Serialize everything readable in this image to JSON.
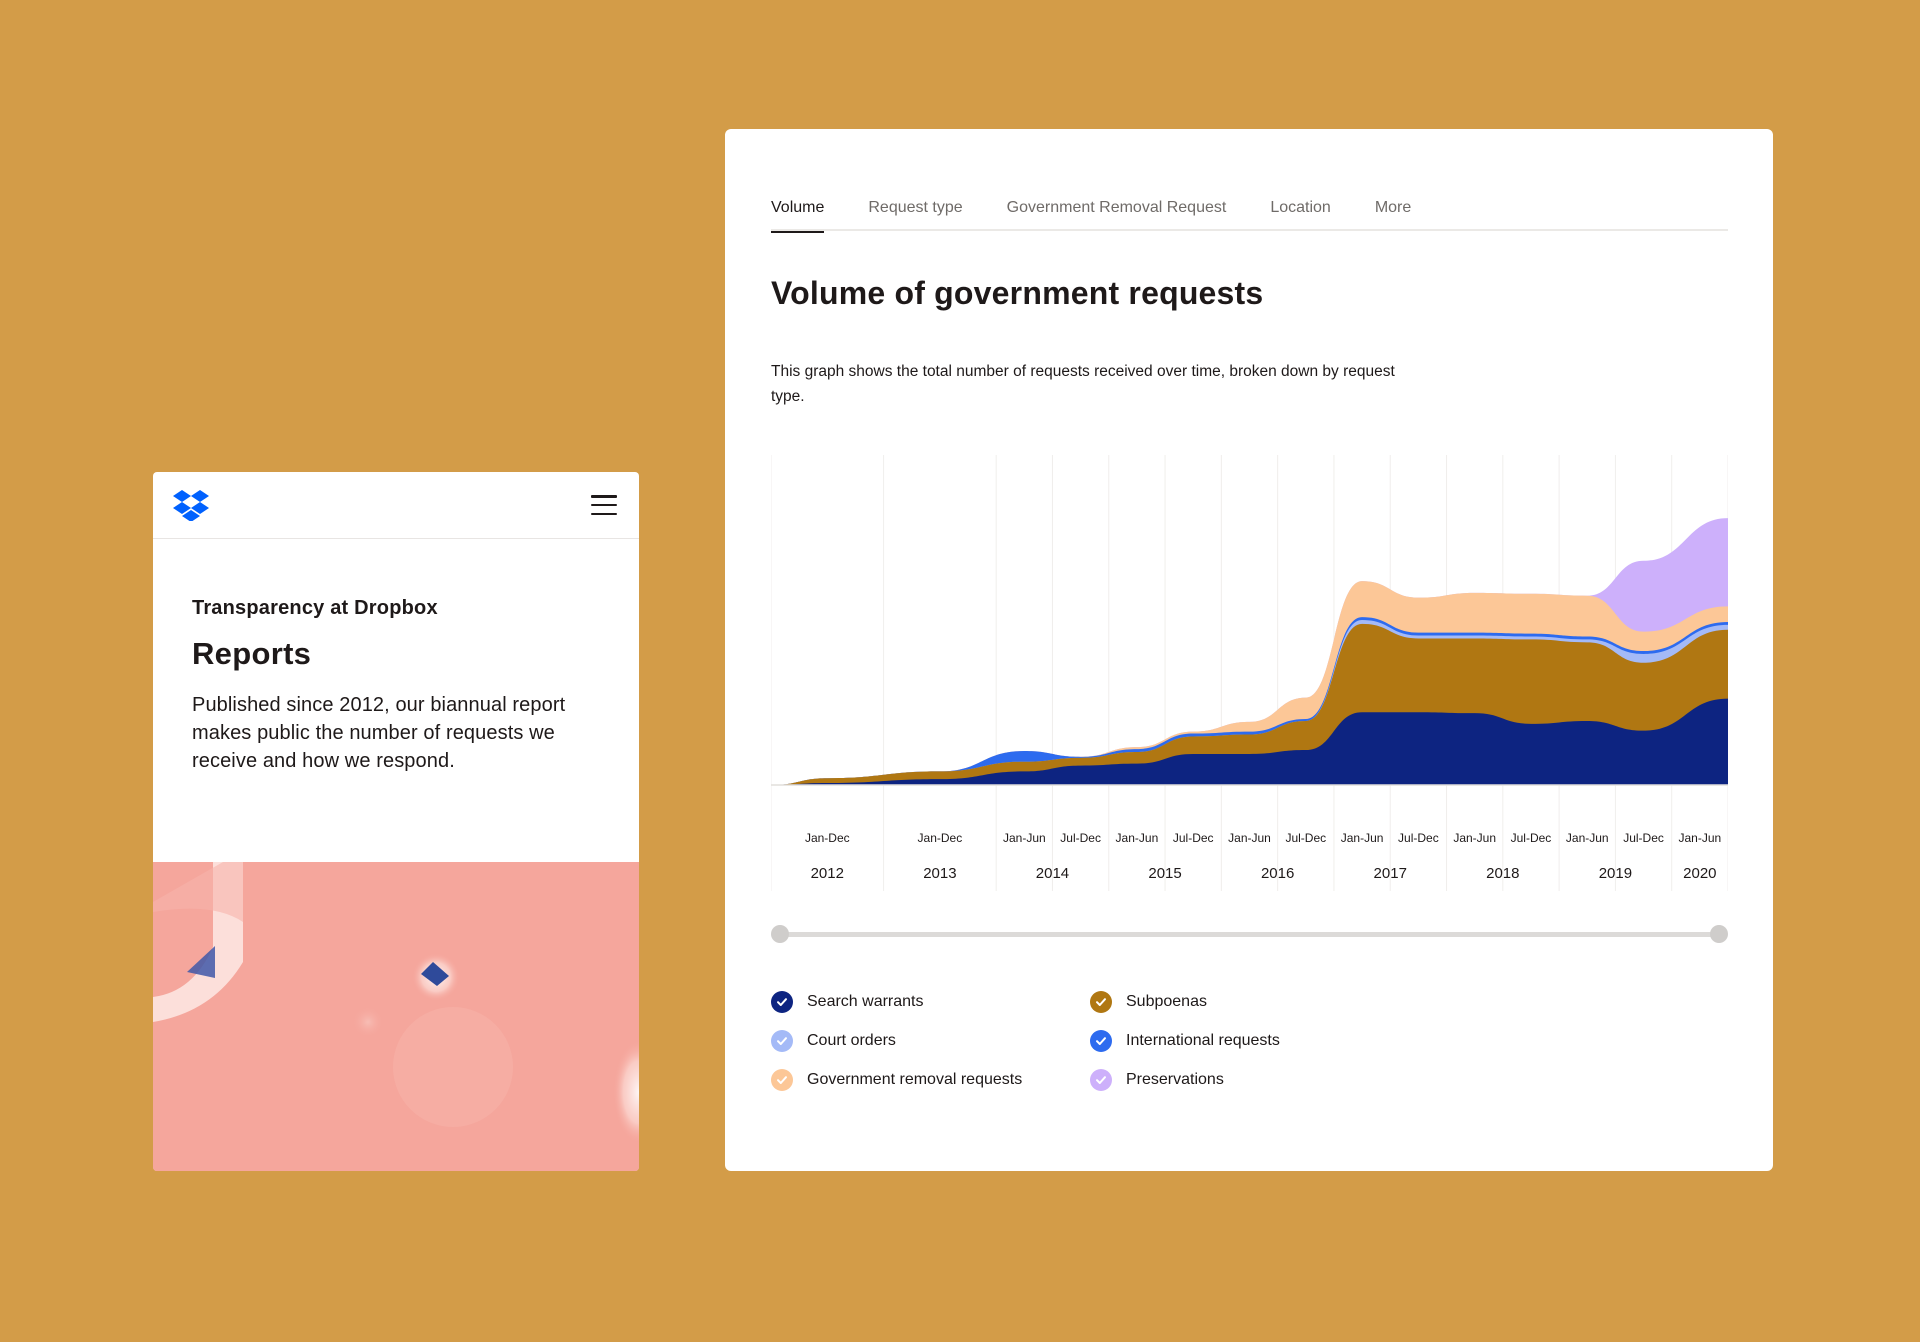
{
  "mobile": {
    "eyebrow": "Transparency at Dropbox",
    "title": "Reports",
    "description": "Published since 2012, our biannual report makes public the number of requests we receive and how we respond.",
    "logo_icon": "dropbox-logo-icon",
    "menu_icon": "hamburger-menu-icon",
    "brand_color": "#0061fe"
  },
  "tabs": [
    {
      "label": "Volume",
      "active": true
    },
    {
      "label": "Request type",
      "active": false
    },
    {
      "label": "Government Removal Request",
      "active": false
    },
    {
      "label": "Location",
      "active": false
    },
    {
      "label": "More",
      "active": false
    }
  ],
  "heading": "Volume of government requests",
  "description": "This graph shows the total number of requests received over time, broken down by request type.",
  "chart_data": {
    "type": "area",
    "stacked": true,
    "grid": true,
    "legend_position": "bottom",
    "periods": [
      {
        "label": "Jan-Dec",
        "year": "2012"
      },
      {
        "label": "Jan-Dec",
        "year": "2013"
      },
      {
        "label": "Jan-Jun",
        "year": "2014"
      },
      {
        "label": "Jul-Dec",
        "year": ""
      },
      {
        "label": "Jan-Jun",
        "year": "2015"
      },
      {
        "label": "Jul-Dec",
        "year": ""
      },
      {
        "label": "Jan-Jun",
        "year": "2016"
      },
      {
        "label": "Jul-Dec",
        "year": ""
      },
      {
        "label": "Jan-Jun",
        "year": "2017"
      },
      {
        "label": "Jul-Dec",
        "year": ""
      },
      {
        "label": "Jan-Jun",
        "year": "2018"
      },
      {
        "label": "Jul-Dec",
        "year": ""
      },
      {
        "label": "Jan-Jun",
        "year": "2019"
      },
      {
        "label": "Jul-Dec",
        "year": ""
      },
      {
        "label": "Jan-Jun",
        "year": "2020"
      }
    ],
    "ylim": [
      0,
      340
    ],
    "series": [
      {
        "name": "Search warrants",
        "color": "#0d2481",
        "values": [
          2,
          6,
          14,
          20,
          22,
          32,
          32,
          36,
          75,
          75,
          74,
          63,
          66,
          56,
          89
        ]
      },
      {
        "name": "Subpoenas",
        "color": "#b07712",
        "values": [
          5,
          8,
          10,
          8,
          12,
          18,
          20,
          30,
          91,
          76,
          77,
          87,
          81,
          70,
          71
        ]
      },
      {
        "name": "Court orders",
        "color": "#a4baf7",
        "values": [
          0,
          0,
          0,
          0,
          0,
          0,
          0,
          0,
          4,
          3,
          3,
          3,
          3,
          9,
          5
        ]
      },
      {
        "name": "International requests",
        "color": "#2d6bef",
        "values": [
          0,
          0,
          11,
          1,
          3,
          3,
          3,
          2,
          3,
          3,
          3,
          3,
          3,
          3,
          3
        ]
      },
      {
        "name": "Government removal requests",
        "color": "#fcc797",
        "values": [
          0,
          0,
          0,
          0,
          2,
          2,
          10,
          22,
          37,
          36,
          41,
          41,
          42,
          20,
          16
        ]
      },
      {
        "name": "Preservations",
        "color": "#cdb0fb",
        "values": [
          0,
          0,
          0,
          0,
          0,
          0,
          0,
          0,
          0,
          0,
          0,
          0,
          0,
          73,
          91
        ]
      }
    ]
  },
  "legend": [
    {
      "label": "Search warrants",
      "color": "#0d2481",
      "icon": "check-icon"
    },
    {
      "label": "Subpoenas",
      "color": "#b07712",
      "icon": "check-icon"
    },
    {
      "label": "Court orders",
      "color": "#a4baf7",
      "icon": "check-icon"
    },
    {
      "label": "International requests",
      "color": "#2d6bef",
      "icon": "check-icon"
    },
    {
      "label": "Government removal requests",
      "color": "#fcc797",
      "icon": "check-icon"
    },
    {
      "label": "Preservations",
      "color": "#cdb0fb",
      "icon": "check-icon"
    }
  ],
  "slider": {
    "start": 0,
    "end": 1
  }
}
